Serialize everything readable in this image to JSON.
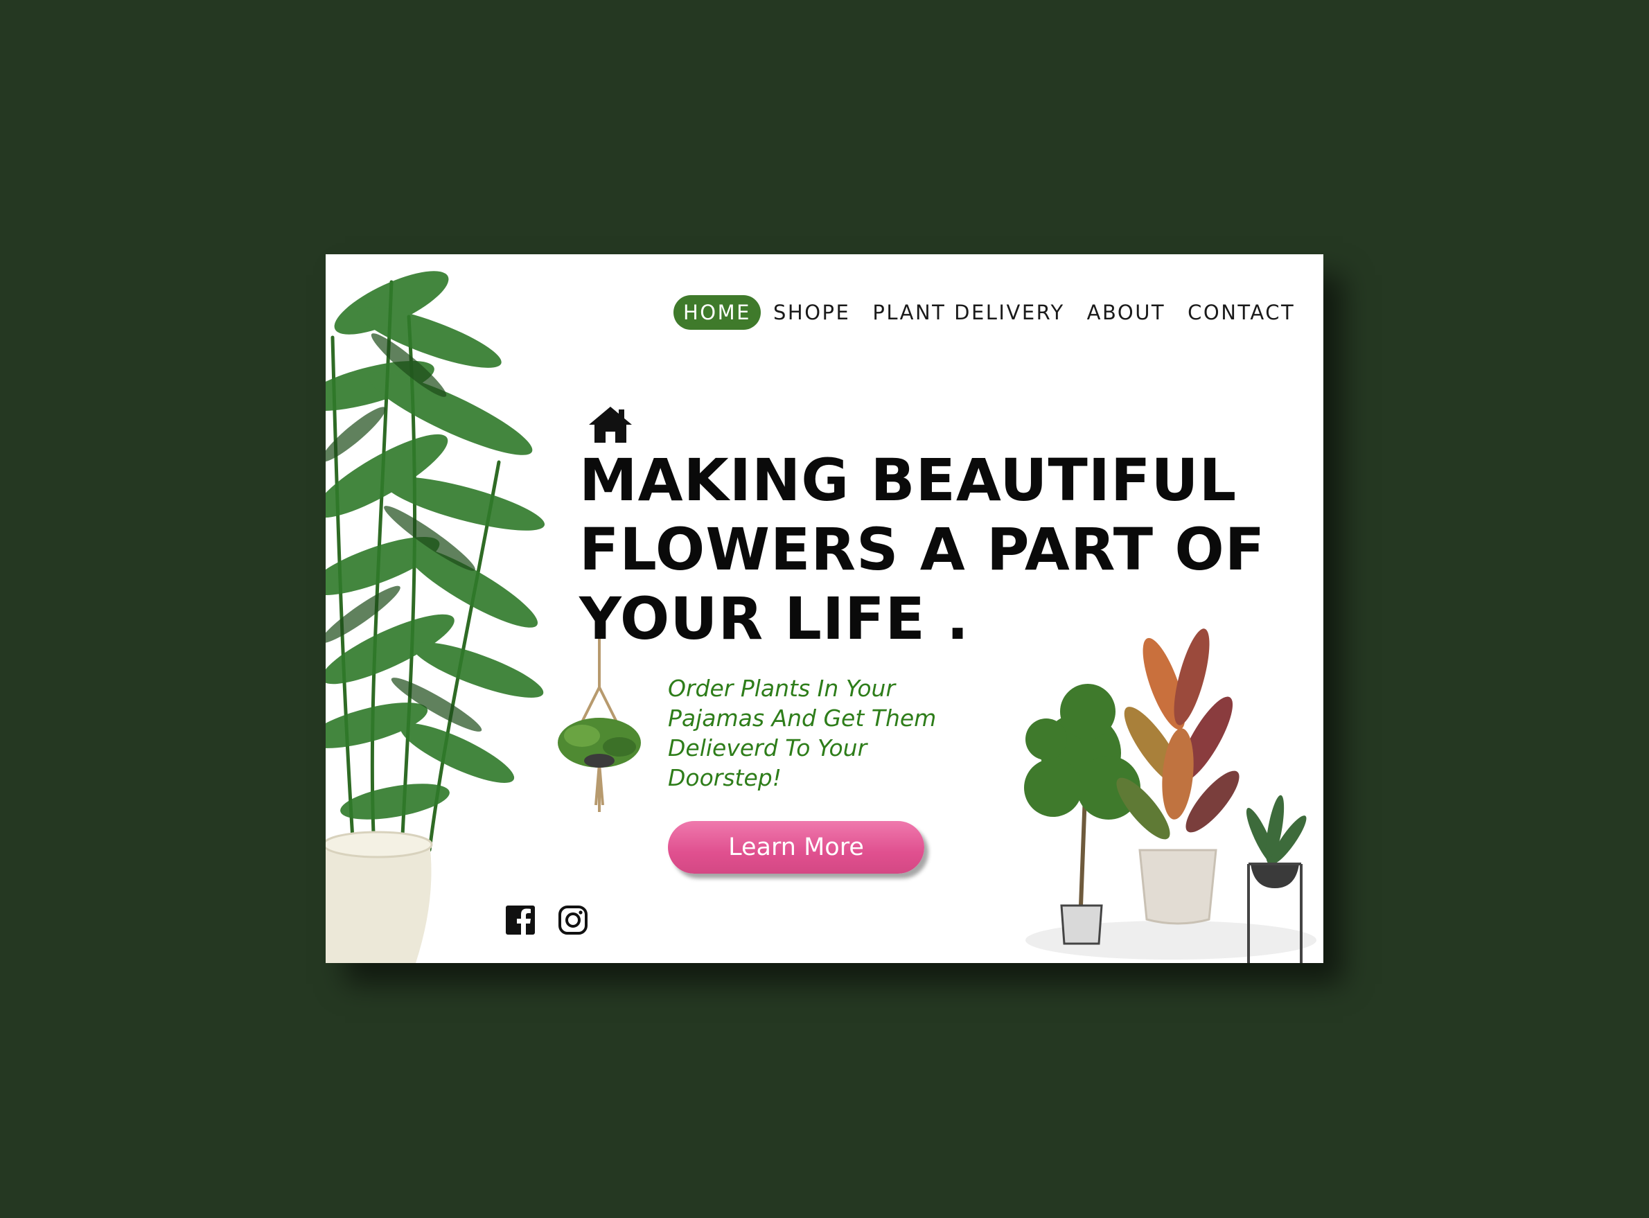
{
  "nav": {
    "items": [
      {
        "label": "HOME",
        "active": true
      },
      {
        "label": "SHOPE",
        "active": false
      },
      {
        "label": "PLANT DELIVERY",
        "active": false
      },
      {
        "label": "ABOUT",
        "active": false
      },
      {
        "label": "CONTACT",
        "active": false
      }
    ]
  },
  "hero": {
    "icon": "home-icon",
    "headline": "MAKING BEAUTIFUL FLOWERS A PART OF YOUR LIFE .",
    "tagline": "Order Plants In Your Pajamas And Get Them Delieverd To Your Doorstep!",
    "button_label": "Learn More"
  },
  "social": {
    "icons": [
      "facebook-icon",
      "instagram-icon"
    ]
  },
  "colors": {
    "background": "#253822",
    "accent_green": "#3f7a2b",
    "tagline_green": "#2e7d1a",
    "button_pink": "#e0508f",
    "headline": "#0a0a0a"
  }
}
